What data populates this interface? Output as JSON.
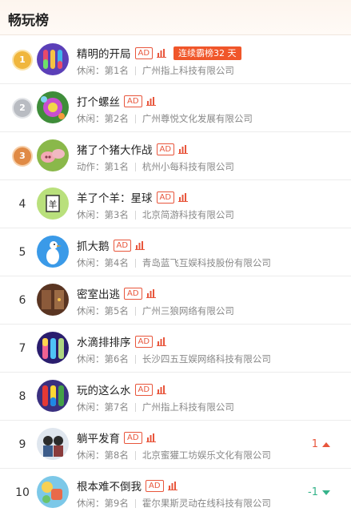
{
  "header": {
    "title": "畅玩榜"
  },
  "ad_label": "AD",
  "colors": {
    "accent": "#e8563c",
    "streak": "#f0562a",
    "up": "#e8563c",
    "down": "#35b38a",
    "medal_gold": "#f0b63d",
    "medal_silver": "#b9bcc2",
    "medal_bronze": "#e08a45"
  },
  "rows": [
    {
      "rank": "1",
      "medal": "gold",
      "name": "精明的开局",
      "category": "休闲：第1名",
      "company": "广州指上科技有限公司",
      "streak": "连续霸榜32 天",
      "icon": "ball-sort-tubes-icon"
    },
    {
      "rank": "2",
      "medal": "silver",
      "name": "打个螺丝",
      "category": "休闲：第2名",
      "company": "广州尊悦文化发展有限公司",
      "icon": "screw-flower-icon"
    },
    {
      "rank": "3",
      "medal": "bronze",
      "name": "猪了个猪大作战",
      "category": "动作：第1名",
      "company": "杭州小每科技有限公司",
      "icon": "pigs-icon"
    },
    {
      "rank": "4",
      "name": "羊了个羊：星球",
      "category": "休闲：第3名",
      "company": "北京简游科技有限公司",
      "icon": "sheep-icon"
    },
    {
      "rank": "5",
      "name": "抓大鹅",
      "category": "休闲：第4名",
      "company": "青岛蓝飞互娱科技股份有限公司",
      "icon": "goose-icon"
    },
    {
      "rank": "6",
      "name": "密室出逃",
      "category": "休闲：第5名",
      "company": "广州三狼网络有限公司",
      "icon": "escape-room-icon"
    },
    {
      "rank": "7",
      "name": "水滴排排序",
      "category": "休闲：第6名",
      "company": "长沙四五互娱网络科技有限公司",
      "icon": "water-sort-icon"
    },
    {
      "rank": "8",
      "name": "玩的这么水",
      "category": "休闲：第7名",
      "company": "广州指上科技有限公司",
      "icon": "water-tubes-icon"
    },
    {
      "rank": "9",
      "name": "躺平发育",
      "category": "休闲：第8名",
      "company": "北京蜜獾工坊娱乐文化有限公司",
      "change": "1",
      "change_dir": "up",
      "icon": "lying-flat-icon"
    },
    {
      "rank": "10",
      "name": "根本难不倒我",
      "category": "休闲：第9名",
      "company": "霍尔果斯灵动在线科技有限公司",
      "change": "-1",
      "change_dir": "down",
      "icon": "puzzle-icon"
    }
  ]
}
